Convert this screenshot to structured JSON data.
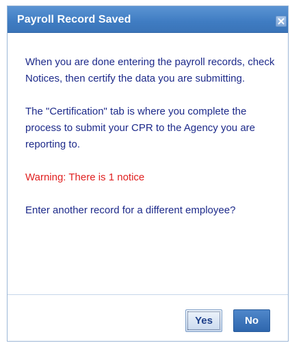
{
  "dialog": {
    "title": "Payroll Record Saved",
    "close_icon": "close-icon",
    "paragraphs": [
      "When you are done entering the payroll records, check Notices, then certify the data you are submitting.",
      "The \"Certification\" tab is where you complete the process to submit your CPR to the Agency you are reporting to."
    ],
    "warning": "Warning: There is 1 notice",
    "question": "Enter another record for a different employee?",
    "buttons": {
      "yes_label": "Yes",
      "no_label": "No"
    }
  },
  "colors": {
    "titlebar": "#3f7cc2",
    "text": "#1d2a8a",
    "warning": "#e02020",
    "primary_button": "#2e66ad"
  }
}
